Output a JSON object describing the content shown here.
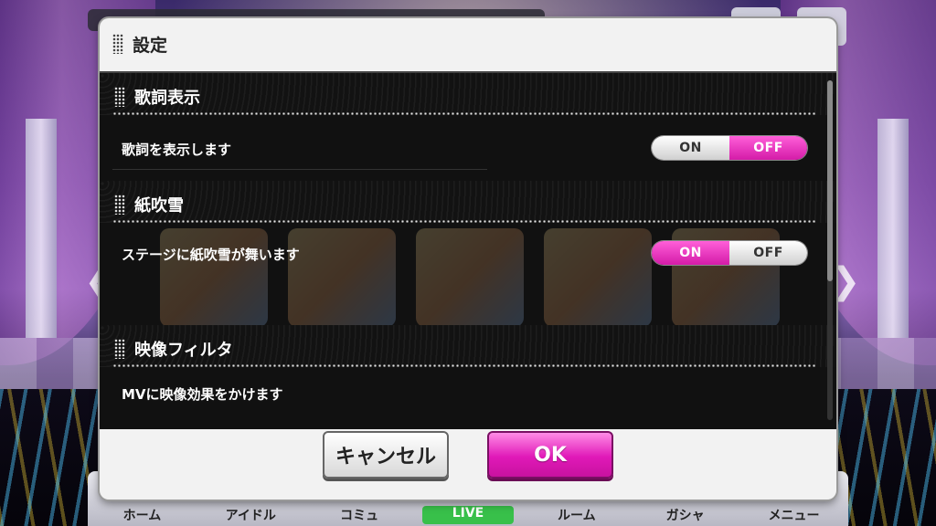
{
  "dialog": {
    "title": "設定",
    "sections": [
      {
        "title": "歌詞表示",
        "description": "歌詞を表示します",
        "selected": "OFF"
      },
      {
        "title": "紙吹雪",
        "description": "ステージに紙吹雪が舞います",
        "selected": "ON"
      },
      {
        "title": "映像フィルタ",
        "description": "MVに映像効果をかけます"
      }
    ],
    "toggle": {
      "on_label": "ON",
      "off_label": "OFF"
    },
    "cancel_label": "キャンセル",
    "ok_label": "OK",
    "scroll_position": 0.0
  },
  "background_nav": {
    "items": [
      "ホーム",
      "アイドル",
      "コミュ",
      "LIVE",
      "ルーム",
      "ガシャ",
      "メニュー"
    ]
  },
  "colors": {
    "accent_pink": "#e019b8",
    "panel_dark": "#111111",
    "dialog_bg": "#f2f2f2"
  },
  "icons": {
    "grip": "dotted-grip-icon",
    "left_arrow": "chevron-left-icon",
    "right_arrow": "chevron-right-icon"
  }
}
